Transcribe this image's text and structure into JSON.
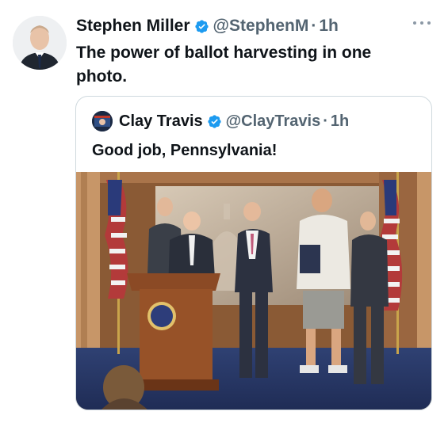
{
  "tweet": {
    "author_name": "Stephen Miller",
    "handle": "@StephenM",
    "separator": "·",
    "time": "1h",
    "text": "The power of ballot harvesting in one photo."
  },
  "quoted_tweet": {
    "author_name": "Clay Travis",
    "handle": "@ClayTravis",
    "separator": "·",
    "time": "1h",
    "text": "Good job, Pennsylvania!"
  },
  "icons": {
    "verified": "verified-badge-icon",
    "more": "more-options-icon"
  },
  "colors": {
    "verified_blue": "#1d9bf0",
    "text_primary": "#0f1419",
    "text_secondary": "#536471",
    "border": "#cfd9de"
  }
}
